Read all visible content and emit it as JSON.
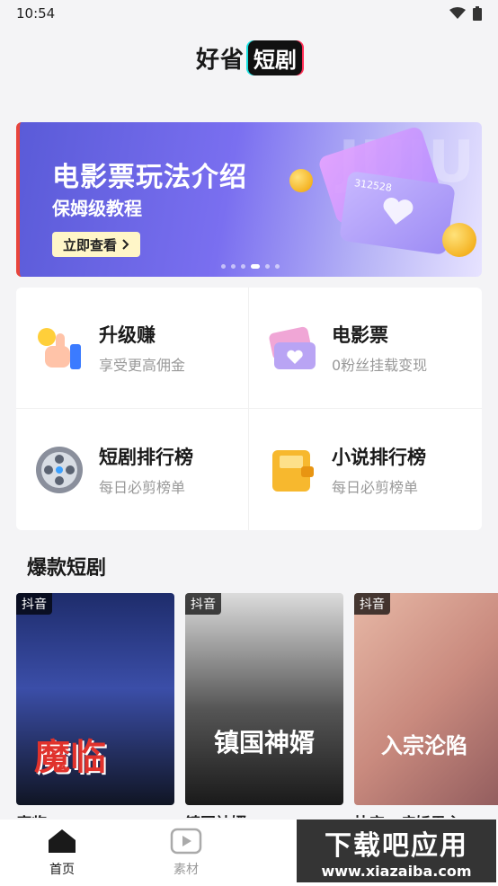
{
  "status": {
    "time": "10:54"
  },
  "header": {
    "logo_part1": "好省",
    "logo_part2": "短剧"
  },
  "banner": {
    "title": "电影票玩法介绍",
    "subtitle": "保姆级教程",
    "button_label": "立即查看",
    "bg_text": "JUJU",
    "ticket_code": "312528",
    "dots_total": 6,
    "dots_active_index": 3
  },
  "features": [
    {
      "title": "升级赚",
      "subtitle": "享受更高佣金",
      "icon": "thumbs-up-coin-icon"
    },
    {
      "title": "电影票",
      "subtitle": "0粉丝挂载变现",
      "icon": "movie-ticket-icon"
    },
    {
      "title": "短剧排行榜",
      "subtitle": "每日必剪榜单",
      "icon": "film-reel-icon"
    },
    {
      "title": "小说排行榜",
      "subtitle": "每日必剪榜单",
      "icon": "wallet-book-icon"
    }
  ],
  "section": {
    "title": "爆款短剧"
  },
  "dramas": [
    {
      "platform": "抖音",
      "name": "魔临",
      "poster_text": "魔临",
      "color": "#2a3f8a"
    },
    {
      "platform": "抖音",
      "name": "镇国神婿",
      "poster_text": "镇国神婿",
      "color": "#3c3c3c"
    },
    {
      "platform": "抖音",
      "name": "快穿：病娇男主",
      "poster_text": "入宗沦陷",
      "color": "#c98a7e"
    }
  ],
  "tabs": [
    {
      "label": "首页",
      "icon": "home-icon",
      "active": true
    },
    {
      "label": "素材",
      "icon": "video-play-icon",
      "active": false
    }
  ],
  "watermark": {
    "title": "下载吧应用",
    "url": "www.xiazaiba.com"
  }
}
